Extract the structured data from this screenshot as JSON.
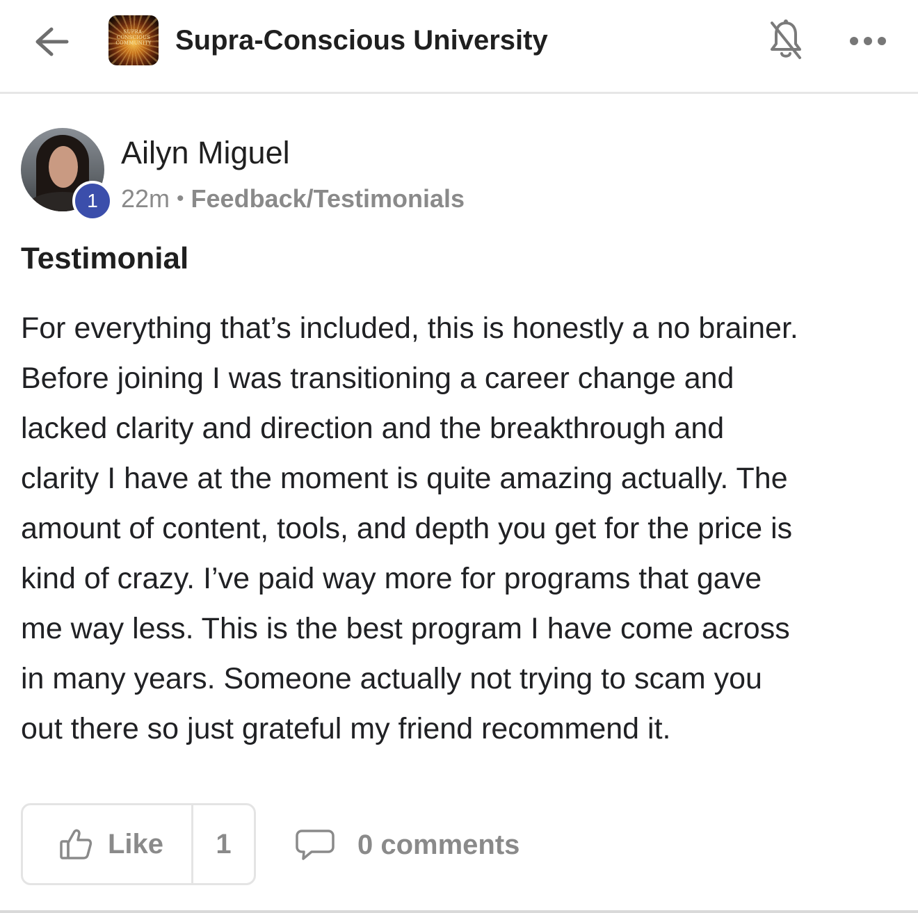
{
  "header": {
    "back_icon": "arrow-left-icon",
    "group_name": "Supra-Conscious University",
    "group_logo_text": "SUPRA-CONSCIOUS COMMUNITY",
    "bell_icon": "bell-off-icon",
    "more_icon": "more-horizontal-icon"
  },
  "post": {
    "author": {
      "name": "Ailyn Miguel",
      "level": "1",
      "level_badge_color": "#3b4eab"
    },
    "time_ago": "22m",
    "separator": "•",
    "category": "Feedback/Testimonials",
    "title": "Testimonial",
    "body_lines": [
      "For everything that’s included, this is honestly a no brainer.",
      "Before joining I was transitioning a career change and",
      "lacked clarity and direction and the breakthrough and",
      "clarity I have at the moment is quite amazing actually. The",
      "amount of content, tools, and depth you get for the price is",
      "kind of crazy. I’ve paid way more for programs that gave",
      "me way less. This is the best program I have come across",
      "in many years. Someone actually not trying to scam you",
      "out there so just grateful my friend recommend it."
    ]
  },
  "actions": {
    "like_label": "Like",
    "like_count": "1",
    "like_icon": "thumbs-up-icon",
    "comments_label": "0 comments",
    "comments_icon": "comment-bubble-icon"
  },
  "colors": {
    "text_primary": "#1f1f1f",
    "text_muted": "#8a8a8a",
    "border": "#e4e4e4"
  }
}
